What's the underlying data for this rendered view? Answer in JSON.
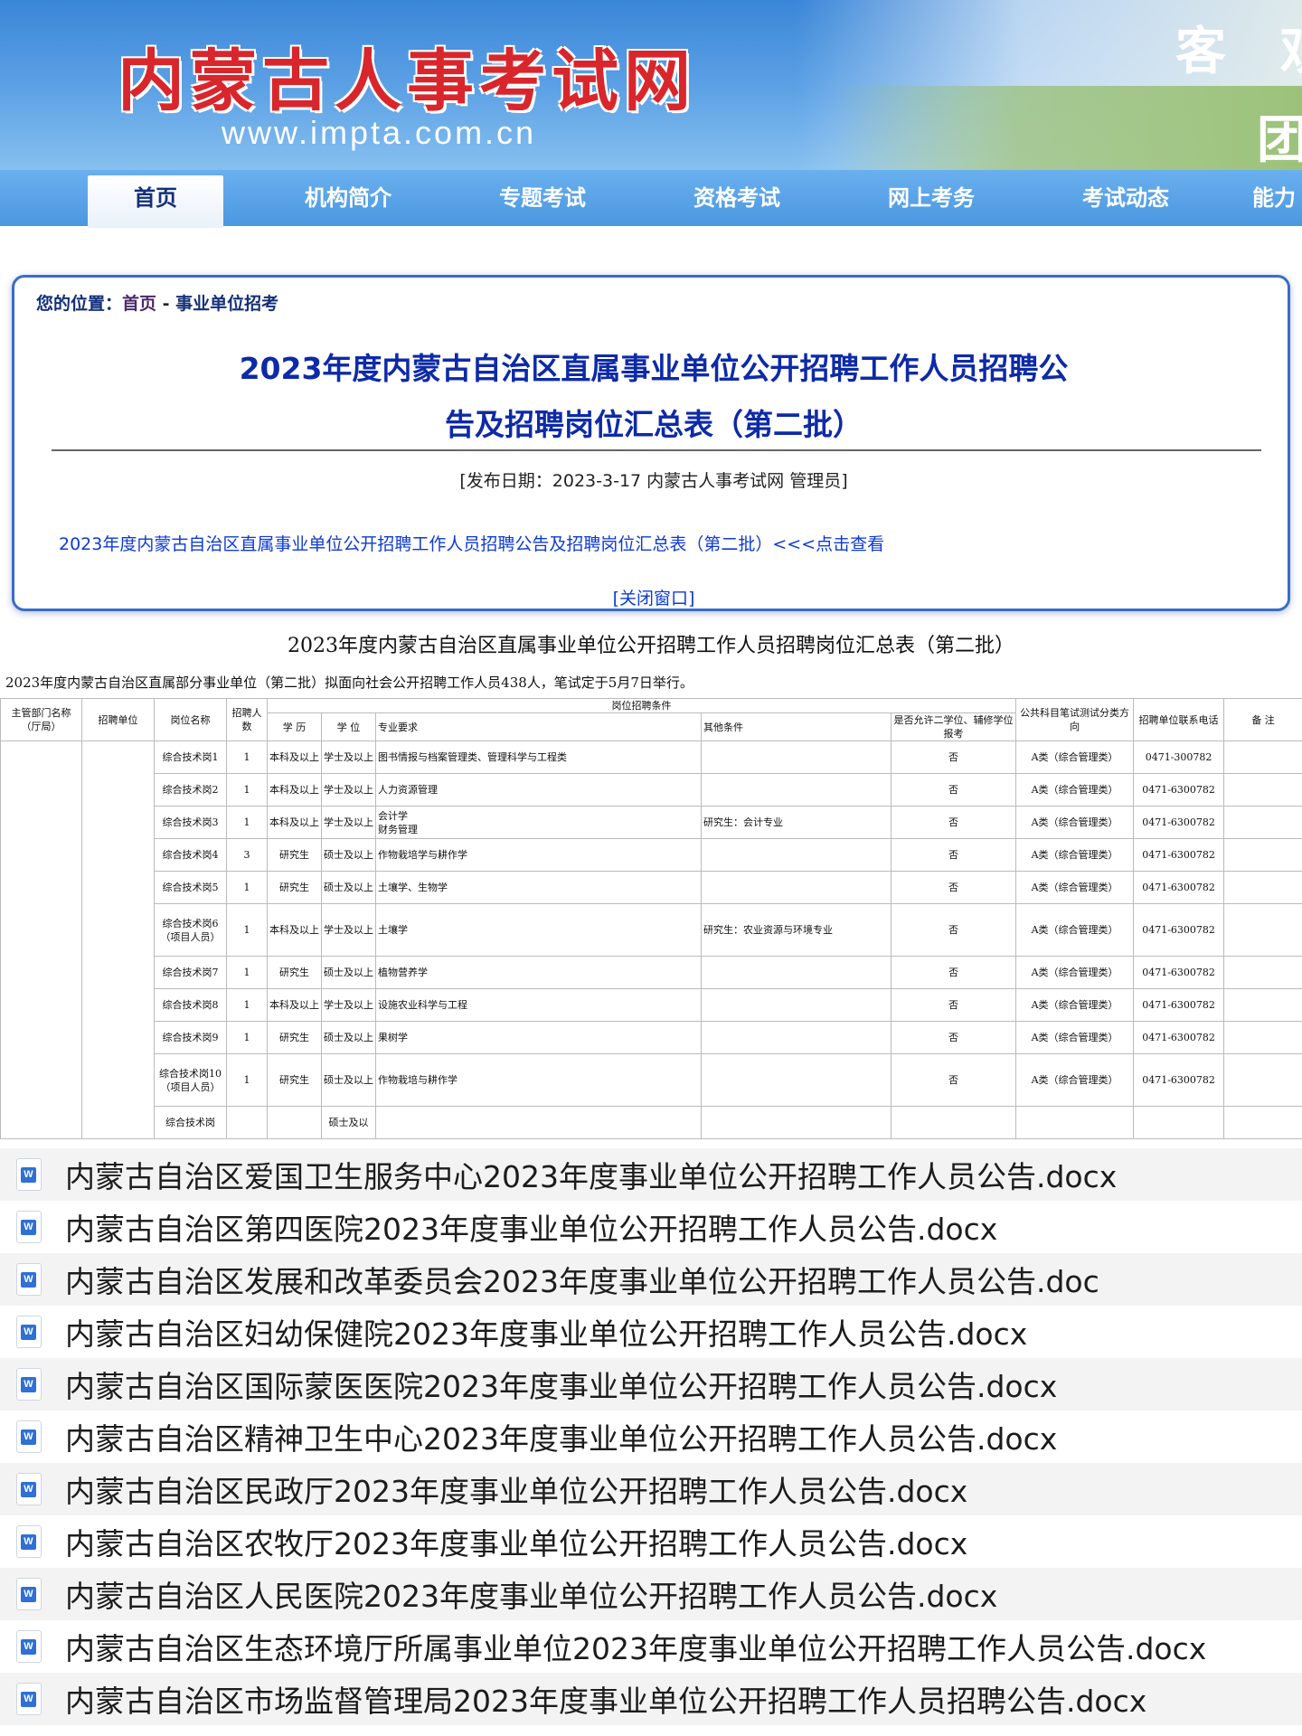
{
  "site": {
    "logo_text": "内蒙古人事考试网",
    "url": "www.impta.com.cn",
    "slogan_top": "客 观",
    "slogan_bottom": "团"
  },
  "nav": {
    "items": [
      {
        "label": "首页",
        "active": true
      },
      {
        "label": "机构简介"
      },
      {
        "label": "专题考试"
      },
      {
        "label": "资格考试"
      },
      {
        "label": "网上考务"
      },
      {
        "label": "考试动态"
      },
      {
        "label": "能力"
      }
    ]
  },
  "breadcrumb": {
    "label": "您的位置：",
    "home": "首页",
    "separator": " - ",
    "section": "事业单位招考"
  },
  "article": {
    "title_line1": "2023年度内蒙古自治区直属事业单位公开招聘工作人员招聘公",
    "title_line2": "告及招聘岗位汇总表（第二批）",
    "meta": "[发布日期：2023-3-17 内蒙古人事考试网 管理员]",
    "link_text": "2023年度内蒙古自治区直属事业单位公开招聘工作人员招聘公告及招聘岗位汇总表（第二批）<<<点击查看",
    "close_text": "[关闭窗口]"
  },
  "sheet": {
    "title": "2023年度内蒙古自治区直属事业单位公开招聘工作人员招聘岗位汇总表（第二批）",
    "intro": "2023年度内蒙古自治区直属部分事业单位（第二批）拟面向社会公开招聘工作人员438人，笔试定于5月7日举行。",
    "headers": {
      "dept": "主管部门名称（厅局）",
      "unit": "招聘单位",
      "post": "岗位名称",
      "count": "招聘人数",
      "conditions": "岗位招聘条件",
      "education": "学 历",
      "degree": "学 位",
      "major": "专业要求",
      "other": "其他条件",
      "second_degree": "是否允许二学位、辅修学位报考",
      "exam": "公共科目笔试测试分类方向",
      "phone": "招聘单位联系电话",
      "note": "备 注"
    },
    "rows": [
      {
        "post": "综合技术岗1",
        "count": "1",
        "education": "本科及以上",
        "degree": "学士及以上",
        "major": "图书情报与档案管理类、管理科学与工程类",
        "other": "",
        "second": "否",
        "exam": "A类（综合管理类）",
        "phone": "0471-300782",
        "tall": false
      },
      {
        "post": "综合技术岗2",
        "count": "1",
        "education": "本科及以上",
        "degree": "学士及以上",
        "major": "人力资源管理",
        "other": "",
        "second": "否",
        "exam": "A类（综合管理类）",
        "phone": "0471-6300782",
        "tall": false
      },
      {
        "post": "综合技术岗3",
        "count": "1",
        "education": "本科及以上",
        "degree": "学士及以上",
        "major": "会计学\n财务管理",
        "other": "研究生：会计专业",
        "second": "否",
        "exam": "A类（综合管理类）",
        "phone": "0471-6300782",
        "tall": false
      },
      {
        "post": "综合技术岗4",
        "count": "3",
        "education": "研究生",
        "degree": "硕士及以上",
        "major": "作物栽培学与耕作学",
        "other": "",
        "second": "否",
        "exam": "A类（综合管理类）",
        "phone": "0471-6300782",
        "tall": false
      },
      {
        "post": "综合技术岗5",
        "count": "1",
        "education": "研究生",
        "degree": "硕士及以上",
        "major": "土壤学、生物学",
        "other": "",
        "second": "否",
        "exam": "A类（综合管理类）",
        "phone": "0471-6300782",
        "tall": false
      },
      {
        "post": "综合技术岗6（项目人员）",
        "count": "1",
        "education": "本科及以上",
        "degree": "学士及以上",
        "major": "土壤学",
        "other": "研究生：农业资源与环境专业",
        "second": "否",
        "exam": "A类（综合管理类）",
        "phone": "0471-6300782",
        "tall": true
      },
      {
        "post": "综合技术岗7",
        "count": "1",
        "education": "研究生",
        "degree": "硕士及以上",
        "major": "植物营养学",
        "other": "",
        "second": "否",
        "exam": "A类（综合管理类）",
        "phone": "0471-6300782",
        "tall": false
      },
      {
        "post": "综合技术岗8",
        "count": "1",
        "education": "本科及以上",
        "degree": "学士及以上",
        "major": "设施农业科学与工程",
        "other": "",
        "second": "否",
        "exam": "A类（综合管理类）",
        "phone": "0471-6300782",
        "tall": false
      },
      {
        "post": "综合技术岗9",
        "count": "1",
        "education": "研究生",
        "degree": "硕士及以上",
        "major": "果树学",
        "other": "",
        "second": "否",
        "exam": "A类（综合管理类）",
        "phone": "0471-6300782",
        "tall": false
      },
      {
        "post": "综合技术岗10（项目人员）",
        "count": "1",
        "education": "研究生",
        "degree": "硕士及以上",
        "major": "作物栽培与耕作学",
        "other": "",
        "second": "否",
        "exam": "A类（综合管理类）",
        "phone": "0471-6300782",
        "tall": true
      },
      {
        "post": "综合技术岗",
        "count": "",
        "education": "",
        "degree": "硕士及以",
        "major": "",
        "other": "",
        "second": "",
        "exam": "",
        "phone": "",
        "tall": false
      }
    ]
  },
  "files": [
    "内蒙古自治区爱国卫生服务中心2023年度事业单位公开招聘工作人员公告.docx",
    "内蒙古自治区第四医院2023年度事业单位公开招聘工作人员公告.docx",
    "内蒙古自治区发展和改革委员会2023年度事业单位公开招聘工作人员公告.doc",
    "内蒙古自治区妇幼保健院2023年度事业单位公开招聘工作人员公告.docx",
    "内蒙古自治区国际蒙医医院2023年度事业单位公开招聘工作人员公告.docx",
    "内蒙古自治区精神卫生中心2023年度事业单位公开招聘工作人员公告.docx",
    "内蒙古自治区民政厅2023年度事业单位公开招聘工作人员公告.docx",
    "内蒙古自治区农牧厅2023年度事业单位公开招聘工作人员公告.docx",
    "内蒙古自治区人民医院2023年度事业单位公开招聘工作人员公告.docx",
    "内蒙古自治区生态环境厅所属事业单位2023年度事业单位公开招聘工作人员公告.docx",
    "内蒙古自治区市场监督管理局2023年度事业单位公开招聘工作人员招聘公告.docx"
  ],
  "file_icon_letter": "W",
  "colors": {
    "logo_red": "#d8262c",
    "nav_blue": "#4b97e0",
    "title_navy": "#0d2aa8",
    "link_blue": "#0d3ad4",
    "word_blue": "#2f6fd6"
  }
}
